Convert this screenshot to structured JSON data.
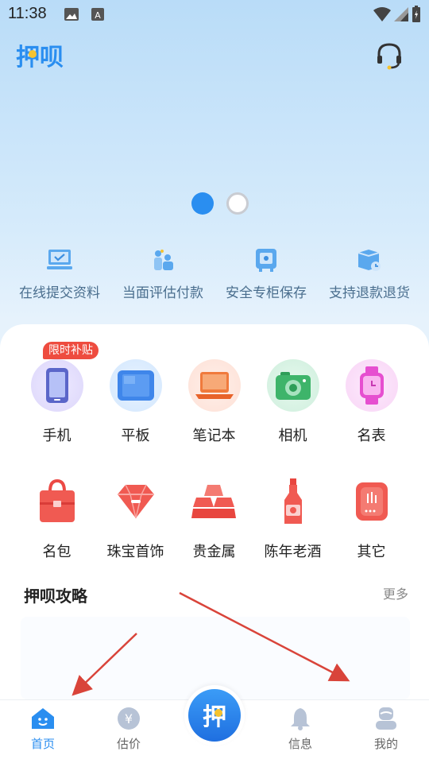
{
  "status": {
    "time": "11:38"
  },
  "header": {
    "logo_text": "押呗"
  },
  "banner": {
    "pages": 2,
    "active_page": 1
  },
  "features": [
    {
      "label": "在线提交资料",
      "icon": "laptop-check-icon"
    },
    {
      "label": "当面评估付款",
      "icon": "people-icon"
    },
    {
      "label": "安全专柜保存",
      "icon": "safe-icon"
    },
    {
      "label": "支持退款退货",
      "icon": "return-box-icon"
    }
  ],
  "badge": "限时补贴",
  "categories": [
    {
      "label": "手机",
      "icon": "phone-icon"
    },
    {
      "label": "平板",
      "icon": "tablet-icon"
    },
    {
      "label": "笔记本",
      "icon": "laptop-icon"
    },
    {
      "label": "相机",
      "icon": "camera-icon"
    },
    {
      "label": "名表",
      "icon": "watch-icon"
    },
    {
      "label": "名包",
      "icon": "handbag-icon"
    },
    {
      "label": "珠宝首饰",
      "icon": "gem-icon"
    },
    {
      "label": "贵金属",
      "icon": "gold-bars-icon"
    },
    {
      "label": "陈年老酒",
      "icon": "liquor-bottle-icon"
    },
    {
      "label": "其它",
      "icon": "other-icon"
    }
  ],
  "guide": {
    "title": "押呗攻略",
    "more": "更多"
  },
  "nav": [
    {
      "label": "首页",
      "icon": "home-icon",
      "active": true
    },
    {
      "label": "估价",
      "icon": "yuan-icon",
      "active": false
    },
    {
      "label": "信息",
      "icon": "bell-icon",
      "active": false
    },
    {
      "label": "我的",
      "icon": "profile-icon",
      "active": false
    }
  ],
  "center_button": {
    "text": "押"
  },
  "colors": {
    "accent": "#2a8ef0",
    "badge": "#ee4c3f",
    "annotation": "#d9443a"
  }
}
